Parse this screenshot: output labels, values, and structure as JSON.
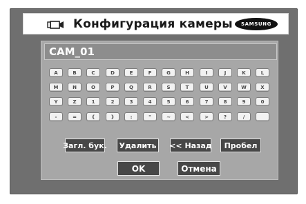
{
  "header": {
    "title": "Конфигурация камеры",
    "icon": "camera-icon",
    "brand": "SAMSUNG"
  },
  "name_field": {
    "value": "CAM_01"
  },
  "keyboard": {
    "rows": [
      [
        "A",
        "B",
        "C",
        "D",
        "E",
        "F",
        "G",
        "H",
        "I",
        "J",
        "K",
        "L"
      ],
      [
        "M",
        "N",
        "O",
        "P",
        "Q",
        "R",
        "S",
        "T",
        "U",
        "V",
        "W",
        "X"
      ],
      [
        "Y",
        "Z",
        "1",
        "2",
        "3",
        "4",
        "5",
        "6",
        "7",
        "8",
        "9",
        "0"
      ],
      [
        "-",
        "=",
        "{",
        "}",
        ":",
        "\"",
        "~",
        "<",
        ">",
        "?",
        "/",
        ""
      ]
    ]
  },
  "actions": {
    "caps": "Загл. бук.",
    "delete": "Удалить",
    "back": "<< Назад",
    "space": "Пробел"
  },
  "dialog": {
    "ok": "OK",
    "cancel": "Отмена"
  },
  "colors": {
    "frame": "#6f6f6f",
    "panel": "#a7a7a7",
    "field": "#8d8d8d",
    "button": "#474747",
    "key": "#f2f2f2"
  }
}
